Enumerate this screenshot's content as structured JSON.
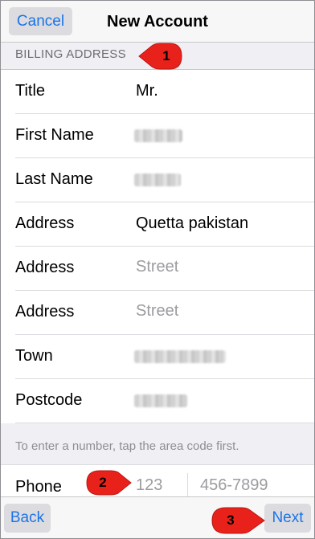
{
  "navbar": {
    "cancel_label": "Cancel",
    "title": "New Account"
  },
  "section": {
    "header": "BILLING ADDRESS"
  },
  "rows": [
    {
      "label": "Title",
      "value": "Mr.",
      "kind": "value"
    },
    {
      "label": "First Name",
      "kind": "redacted"
    },
    {
      "label": "Last Name",
      "kind": "redacted"
    },
    {
      "label": "Address",
      "value": "Quetta pakistan",
      "kind": "value"
    },
    {
      "label": "Address",
      "placeholder": "Street",
      "kind": "placeholder"
    },
    {
      "label": "Address",
      "placeholder": "Street",
      "kind": "placeholder"
    },
    {
      "label": "Town",
      "kind": "redacted"
    },
    {
      "label": "Postcode",
      "kind": "redacted"
    }
  ],
  "hint": "To enter a number, tap the area code first.",
  "phone": {
    "label": "Phone",
    "area_placeholder": "123",
    "number_placeholder": "456-7899"
  },
  "toolbar": {
    "back_label": "Back",
    "next_label": "Next"
  },
  "callouts": [
    "1",
    "2",
    "3"
  ],
  "colors": {
    "accent": "#1a74e8",
    "callout": "#e8221b",
    "background": "#efeff4"
  }
}
